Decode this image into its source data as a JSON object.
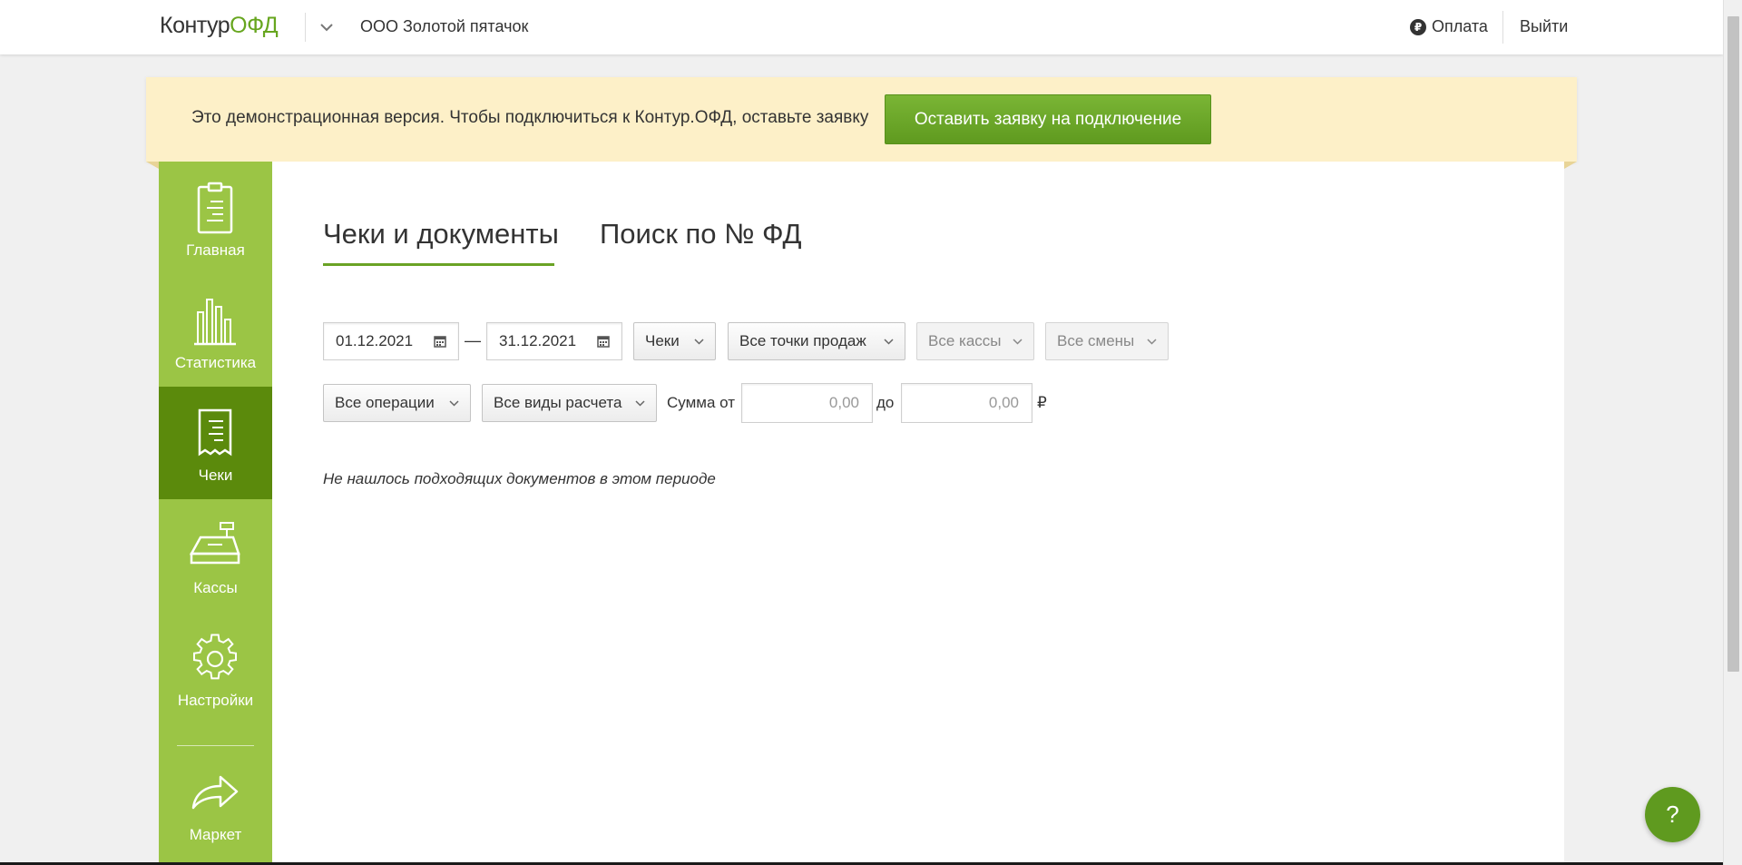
{
  "header": {
    "logo_part1": "Контур",
    "logo_part2": "ОФД",
    "org_name": "ООО Золотой пятачок",
    "pay_label": "Оплата",
    "pay_icon_glyph": "₽",
    "logout_label": "Выйти"
  },
  "banner": {
    "text": "Это демонстрационная версия. Чтобы подключиться к Контур.ОФД, оставьте заявку",
    "button_label": "Оставить заявку на подключение"
  },
  "sidebar": {
    "items": [
      {
        "label": "Главная",
        "icon": "clipboard-icon"
      },
      {
        "label": "Статистика",
        "icon": "bar-chart-icon"
      },
      {
        "label": "Чеки",
        "icon": "receipt-icon",
        "active": true
      },
      {
        "label": "Кассы",
        "icon": "cash-register-icon"
      },
      {
        "label": "Настройки",
        "icon": "gear-icon"
      },
      {
        "label": "Маркет",
        "icon": "forward-arrow-icon"
      }
    ]
  },
  "tabs": [
    {
      "label": "Чеки и документы",
      "active": true
    },
    {
      "label": "Поиск по № ФД",
      "active": false
    }
  ],
  "filters": {
    "date_from": "01.12.2021",
    "date_separator": "—",
    "date_to": "31.12.2021",
    "doc_type": "Чеки",
    "points": "Все точки продаж",
    "kkt": "Все кассы",
    "shifts": "Все смены",
    "operations": "Все операции",
    "payment_types": "Все виды расчета",
    "sum_from_label": "Сумма от",
    "sum_from_placeholder": "0,00",
    "sum_to_label": "до",
    "sum_to_placeholder": "0,00",
    "currency": "₽"
  },
  "empty_message": "Не нашлось подходящих документов в этом периоде",
  "help_label": "?",
  "colors": {
    "brand_green": "#67a61f",
    "sidebar_green": "#9bc545",
    "sidebar_active": "#5b8a0c",
    "banner_bg": "#fdf0c8"
  }
}
